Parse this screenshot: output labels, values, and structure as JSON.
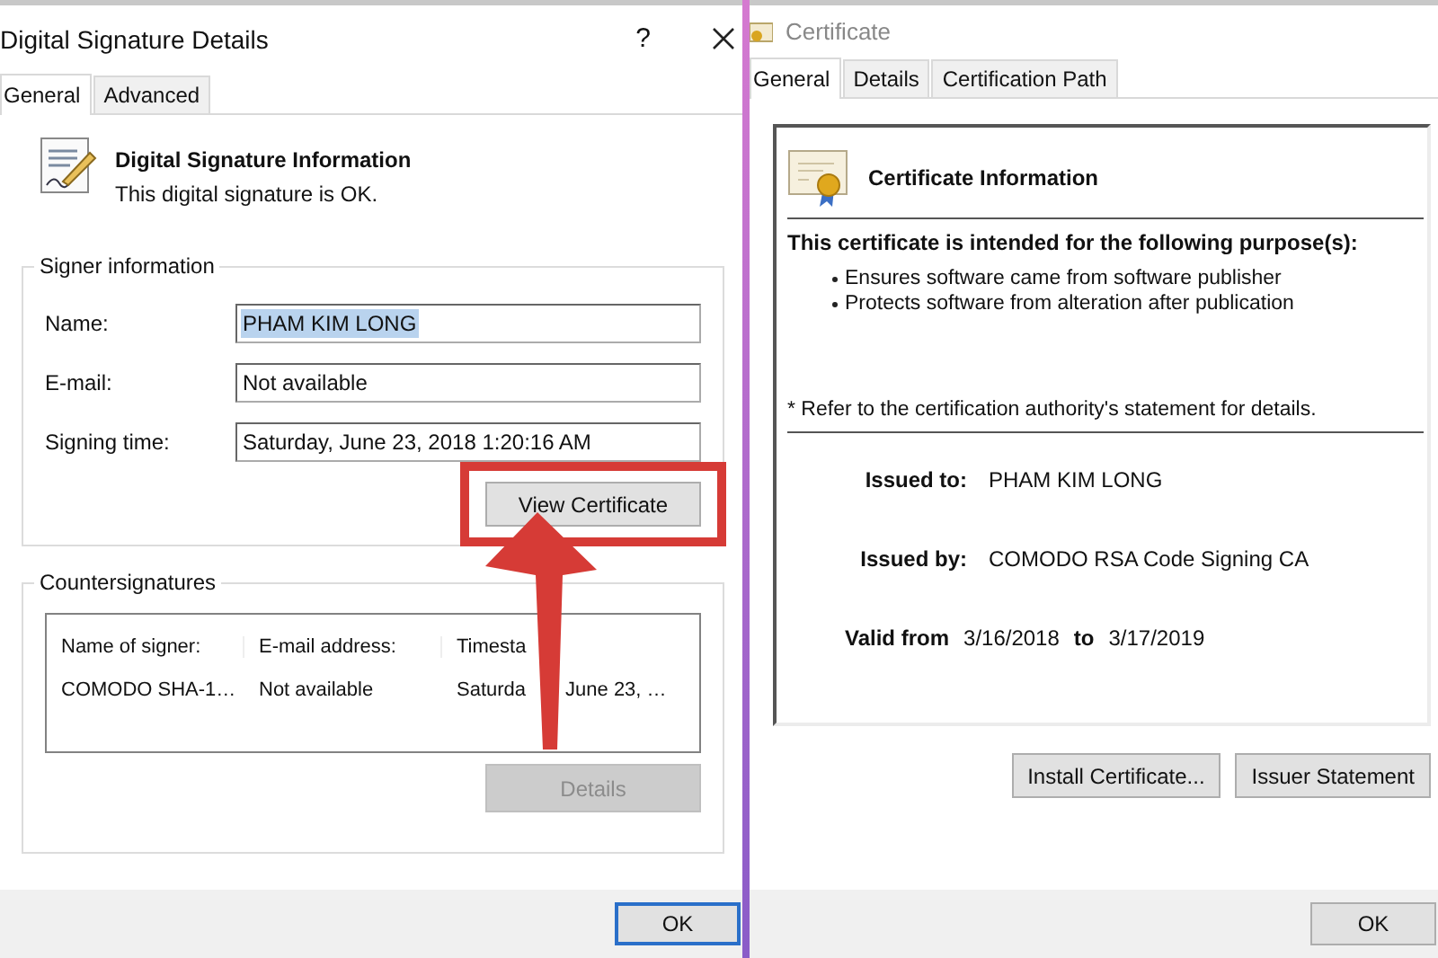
{
  "signature_dialog": {
    "title": "Digital Signature Details",
    "help": "?",
    "tabs": [
      {
        "label": "General",
        "selected": true
      },
      {
        "label": "Advanced",
        "selected": false
      }
    ],
    "header": {
      "title": "Digital Signature Information",
      "subtitle": "This digital signature is OK."
    },
    "signer_information": {
      "legend": "Signer information",
      "fields": [
        {
          "label": "Name:",
          "value": "PHAM KIM LONG",
          "highlighted": true
        },
        {
          "label": "E-mail:",
          "value": "Not available",
          "highlighted": false
        },
        {
          "label": "Signing time:",
          "value": "Saturday, June 23, 2018 1:20:16 AM",
          "highlighted": false
        }
      ],
      "button": {
        "label": "View Certificate",
        "disabled": false
      }
    },
    "countersignatures": {
      "legend": "Countersignatures",
      "columns": [
        "Name of signer:",
        "E-mail address:",
        "Timesta"
      ],
      "rows": [
        {
          "cells": [
            "COMODO SHA-1…",
            "Not available",
            "Saturda"
          ],
          "tail": "June 23, …"
        }
      ],
      "button": {
        "label": "Details",
        "disabled": true
      }
    },
    "ok_button": "OK"
  },
  "certificate_dialog": {
    "title": "Certificate",
    "tabs": [
      {
        "label": "General",
        "selected": true
      },
      {
        "label": "Details",
        "selected": false
      },
      {
        "label": "Certification Path",
        "selected": false
      }
    ],
    "heading": "Certificate Information",
    "purpose_heading": "This certificate is intended for the following purpose(s):",
    "purposes": [
      "Ensures software came from software publisher",
      "Protects software from alteration after publication"
    ],
    "note": "* Refer to the certification authority's statement for details.",
    "issued_to": {
      "label": "Issued to:",
      "value": "PHAM KIM LONG"
    },
    "issued_by": {
      "label": "Issued by:",
      "value": "COMODO RSA Code Signing CA"
    },
    "validity": {
      "from_label": "Valid from",
      "from": "3/16/2018",
      "to_label": "to",
      "to": "3/17/2019"
    },
    "buttons": [
      "Install Certificate...",
      "Issuer Statement"
    ],
    "ok_button": "OK"
  }
}
